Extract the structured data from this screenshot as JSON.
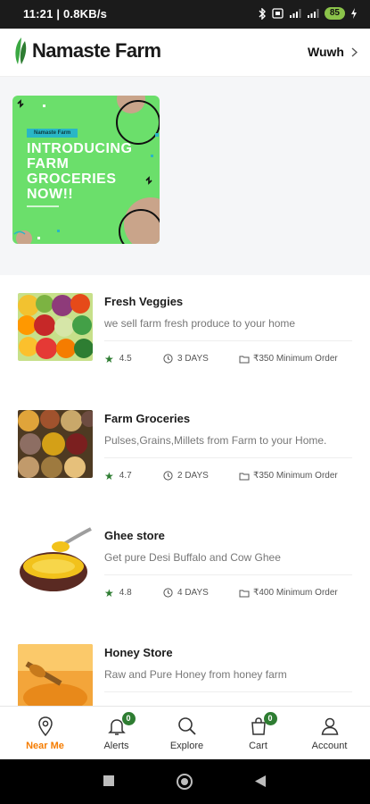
{
  "status_bar": {
    "time": "11:21 | 0.8KB/s",
    "battery": "85"
  },
  "header": {
    "brand": "Namaste Farm",
    "location": "Wuwh"
  },
  "banner": {
    "tag": "Namaste Farm",
    "headline": "INTRODUCING FARM GROCERIES NOW!!"
  },
  "stores": [
    {
      "name": "Fresh Veggies",
      "description": "we sell farm fresh produce to your home",
      "rating": "4.5",
      "delivery": "3 DAYS",
      "min_order": "₹350 Minimum Order"
    },
    {
      "name": "Farm Groceries",
      "description": "Pulses,Grains,Millets from Farm to your Home.",
      "rating": "4.7",
      "delivery": "2 DAYS",
      "min_order": "₹350 Minimum Order"
    },
    {
      "name": "Ghee store",
      "description": "Get pure Desi Buffalo and Cow Ghee",
      "rating": "4.8",
      "delivery": "4 DAYS",
      "min_order": "₹400 Minimum Order"
    },
    {
      "name": "Honey Store",
      "description": "Raw and Pure Honey from honey farm",
      "rating": "",
      "delivery": "",
      "min_order": ""
    }
  ],
  "bottom_nav": [
    {
      "label": "Near Me",
      "icon": "location-pin-icon",
      "active": true
    },
    {
      "label": "Alerts",
      "icon": "bell-icon",
      "badge": "0"
    },
    {
      "label": "Explore",
      "icon": "search-icon"
    },
    {
      "label": "Cart",
      "icon": "shopping-bag-icon",
      "badge": "0"
    },
    {
      "label": "Account",
      "icon": "user-icon"
    }
  ],
  "colors": {
    "accent": "#f57c00",
    "brand_green": "#2e7d32",
    "banner_green": "#6bdf6b"
  }
}
